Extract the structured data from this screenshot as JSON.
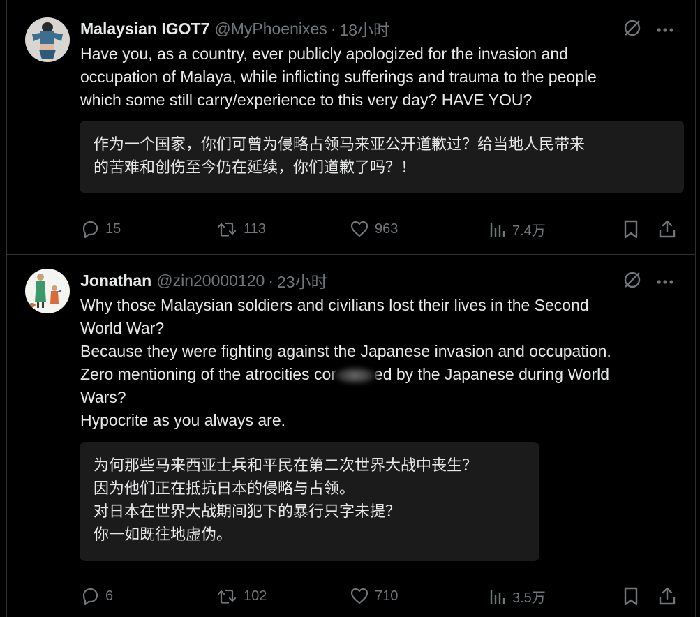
{
  "tweets": [
    {
      "display_name": "Malaysian IGOT7",
      "handle": "@MyPhoenixes",
      "separator": "·",
      "time": "18小时",
      "text_lines": [
        "Have you, as a country, ever publicly apologized for the invasion and",
        "occupation of Malaya, while inflicting sufferings and trauma to the people",
        "which some still carry/experience to this very day? HAVE YOU?"
      ],
      "translation_lines": [
        "作为一个国家，你们可曾为侵略占领马来亚公开道歉过？给当地人民带来",
        "的苦难和创伤至今仍在延续，你们道歉了吗？！"
      ],
      "stats": {
        "replies": "15",
        "retweets": "113",
        "likes": "963",
        "views": "7.4万"
      }
    },
    {
      "display_name": "Jonathan",
      "handle": "@zin20000120",
      "separator": "·",
      "time": "23小时",
      "text_lines": [
        "Why those Malaysian soldiers and civilians lost their lives in the Second",
        "World War?",
        "Because they were fighting against the Japanese invasion and occupation.",
        "Zero mentioning of the atrocities cor",
        "ed by the Japanese during World",
        "Wars?",
        "Hypocrite as you always are."
      ],
      "translation_lines": [
        "为何那些马来西亚士兵和平民在第二次世界大战中丧生？",
        "因为他们正在抵抗日本的侵略与占领。",
        "对日本在世界大战期间犯下的暴行只字未提？",
        "你一如既往地虚伪。"
      ],
      "stats": {
        "replies": "6",
        "retweets": "102",
        "likes": "710",
        "views": "3.5万"
      }
    }
  ],
  "colors": {
    "background": "#000000",
    "text": "#e7e9ea",
    "muted": "#71767b",
    "translation_box": "#1c1b1c",
    "divider": "#2f3336"
  },
  "icons": {
    "grok": "grok-icon",
    "more": "more-dots-icon",
    "reply": "reply-bubble-icon",
    "retweet": "retweet-icon",
    "like": "heart-icon",
    "views": "views-bar-icon",
    "bookmark": "bookmark-icon",
    "share": "share-icon"
  }
}
